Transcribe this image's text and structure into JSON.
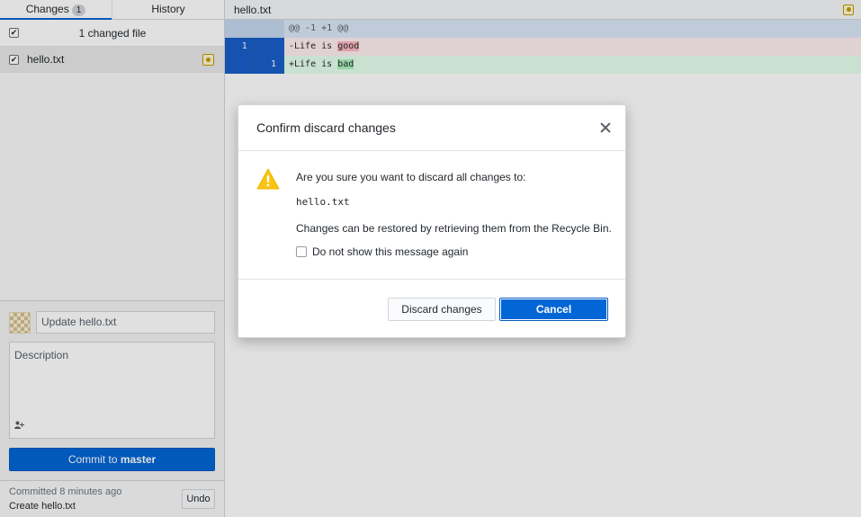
{
  "sidebar": {
    "tabs": [
      {
        "label": "Changes",
        "badge": "1"
      },
      {
        "label": "History"
      }
    ],
    "changes_header": "1 changed file",
    "files": [
      {
        "name": "hello.txt",
        "checked": true
      }
    ],
    "commit": {
      "summary_placeholder": "Update hello.txt",
      "description_placeholder": "Description",
      "button_prefix": "Commit to ",
      "branch": "master"
    },
    "last_commit": {
      "meta": "Committed 8 minutes ago",
      "message": "Create hello.txt",
      "undo_label": "Undo"
    }
  },
  "diff": {
    "file_name": "hello.txt",
    "hunk_header": "@@ -1 +1 @@",
    "deleted": {
      "old_line": "1",
      "prefix": "-Life is ",
      "changed": "good"
    },
    "added": {
      "new_line": "1",
      "prefix": "+Life is ",
      "changed": "bad"
    }
  },
  "dialog": {
    "title": "Confirm discard changes",
    "question": "Are you sure you want to discard all changes to:",
    "file": "hello.txt",
    "restore_note": "Changes can be restored by retrieving them from the Recycle Bin.",
    "dont_show_label": "Do not show this message again",
    "discard_label": "Discard changes",
    "cancel_label": "Cancel"
  },
  "colors": {
    "accent": "#0366d6",
    "warning": "#f9c513",
    "modified": "#c39c00"
  },
  "icons": {
    "dialog": "warning-icon",
    "close": "close-icon",
    "file_status": "modified-file-icon",
    "coauthor": "add-coauthor-icon"
  }
}
